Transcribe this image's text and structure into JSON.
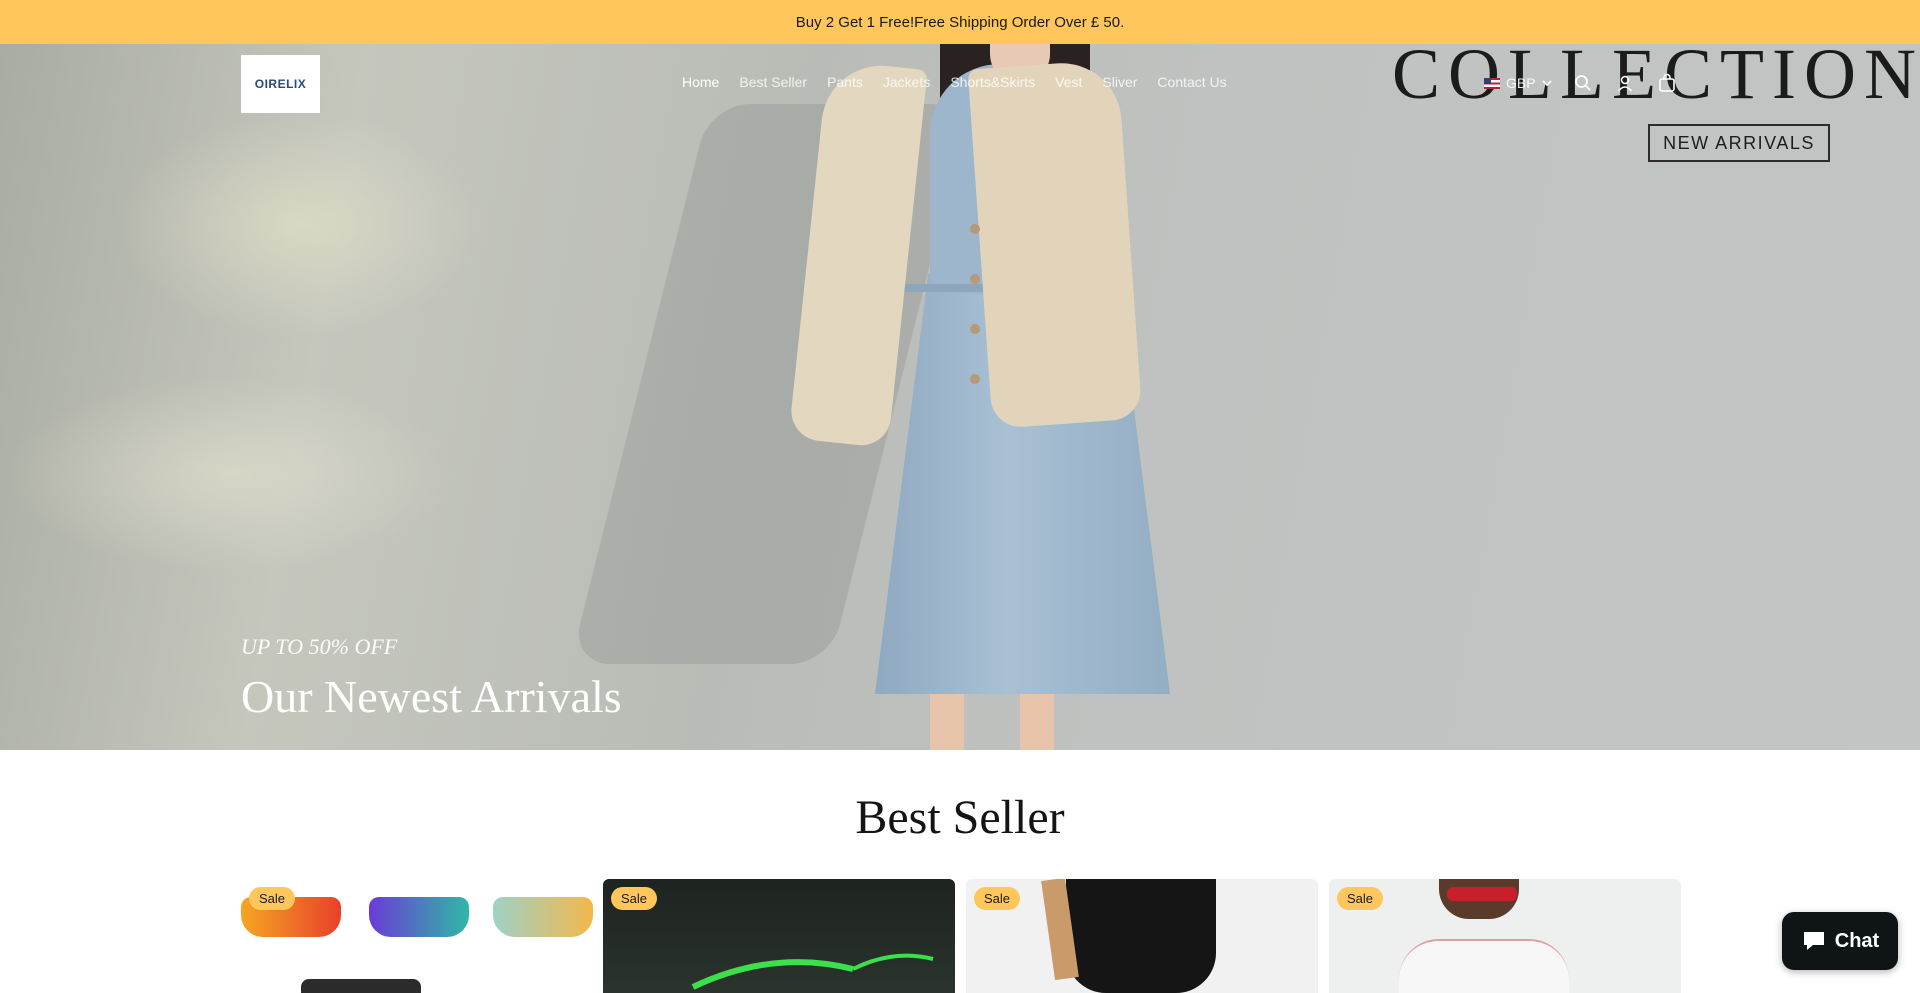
{
  "announcement": {
    "text": "Buy 2 Get 1 Free!Free Shipping Order Over  £ 50."
  },
  "header": {
    "logo_text": "OIRELIX",
    "nav": [
      {
        "label": "Home",
        "active": true
      },
      {
        "label": "Best Seller"
      },
      {
        "label": "Pants"
      },
      {
        "label": "Jackets"
      },
      {
        "label": "Shorts&Skirts"
      },
      {
        "label": "Vest"
      },
      {
        "label": "Sliver"
      },
      {
        "label": "Contact Us"
      }
    ],
    "currency": "GBP"
  },
  "hero": {
    "collection_text": "COLLECTION",
    "new_arrivals_label": "NEW ARRIVALS",
    "subtitle": "UP TO 50% OFF",
    "title": "Our Newest Arrivals"
  },
  "best_seller": {
    "title": "Best Seller",
    "badge_label": "Sale"
  },
  "chat": {
    "label": "Chat"
  },
  "colors": {
    "accent": "#ffc65c",
    "chat_bg": "#0f1417"
  }
}
